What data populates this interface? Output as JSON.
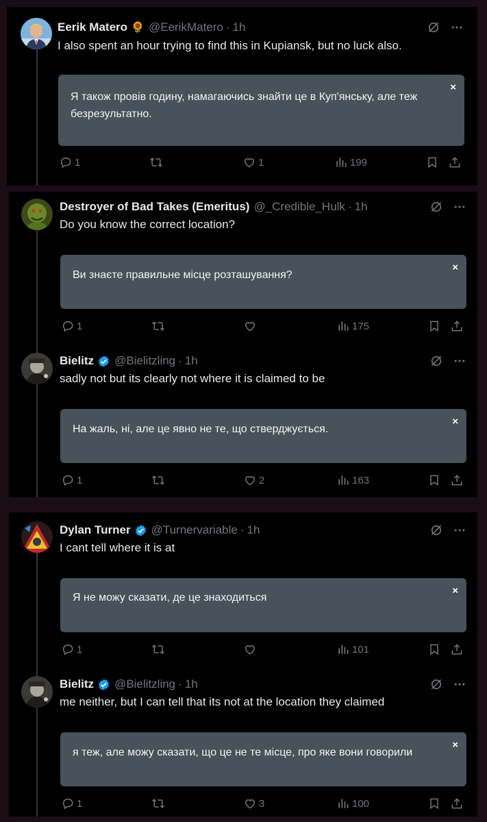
{
  "colors": {
    "background": "#1a0d14",
    "panel": "#000000",
    "translation_box": "#47525a",
    "muted_text": "#71767b",
    "verified_blue": "#1d9bf0"
  },
  "tweets": [
    {
      "display_name": "Eerik Matero",
      "emoji": "🌻",
      "handle": "@EerikMatero",
      "separator": "·",
      "time": "1h",
      "text": "I also spent an hour trying to find this in Kupiansk, but no luck also.",
      "translation_line1": "Я також провів годину, намагаючись знайти це в Куп'янську, але теж",
      "translation_line2": "безрезультатно.",
      "replies": "1",
      "retweets": "",
      "likes": "1",
      "views": "199"
    },
    {
      "display_name": "Destroyer of Bad Takes (Emeritus)",
      "handle": "@_Credible_Hulk",
      "separator": "·",
      "time": "1h",
      "text": "Do you know the correct location?",
      "translation_line1": "Ви знаєте правильне місце розташування?",
      "replies": "1",
      "retweets": "",
      "likes": "",
      "views": "175"
    },
    {
      "display_name": "Bielitz",
      "handle": "@Bielitzling",
      "separator": "·",
      "time": "1h",
      "text": "sadly not but its clearly not where it is claimed to be",
      "translation_line1": "На жаль, ні, але це явно не те, що стверджується.",
      "replies": "1",
      "retweets": "",
      "likes": "2",
      "views": "163"
    },
    {
      "display_name": "Dylan Turner",
      "handle": "@Turnervariable",
      "separator": "·",
      "time": "1h",
      "text": "I cant tell where it is at",
      "translation_line1": "Я не можу сказати, де це знаходиться",
      "replies": "1",
      "retweets": "",
      "likes": "",
      "views": "101"
    },
    {
      "display_name": "Bielitz",
      "handle": "@Bielitzling",
      "separator": "·",
      "time": "1h",
      "text": "me neither, but I can tell that its not at the location they claimed",
      "translation_line1": "я теж, але можу сказати, що це не те місце, про яке вони говорили",
      "replies": "1",
      "retweets": "",
      "likes": "3",
      "views": "100"
    }
  ],
  "close_glyph": "×",
  "icons": {
    "grok": "grok-slash-icon",
    "more": "more-dots-icon",
    "reply": "reply-icon",
    "retweet": "retweet-icon",
    "like": "heart-icon",
    "views": "views-bars-icon",
    "bookmark": "bookmark-icon",
    "share": "share-icon",
    "verified": "verified-badge-icon"
  }
}
